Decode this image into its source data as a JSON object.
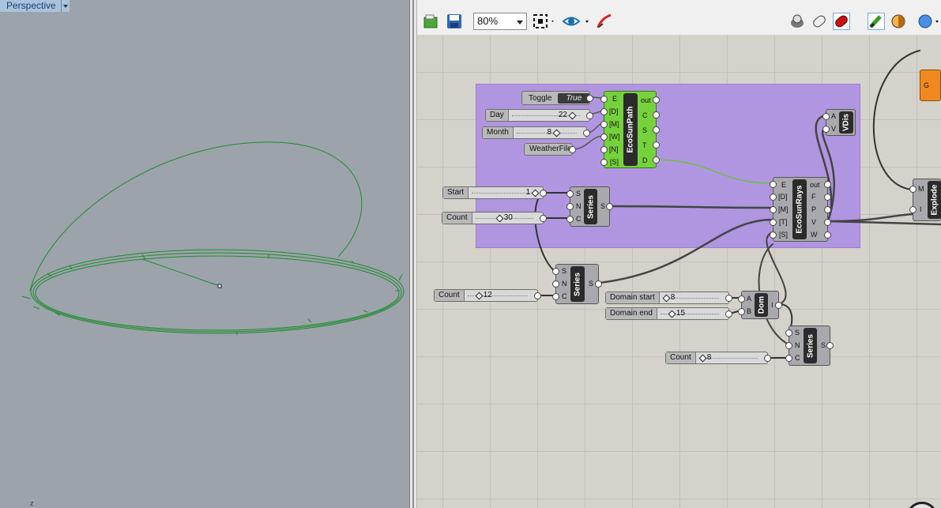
{
  "viewport": {
    "title": "Perspective",
    "axis_label": "z"
  },
  "toolbar": {
    "zoom": "80%"
  },
  "sliders": {
    "day": {
      "label": "Day",
      "value": "22"
    },
    "month": {
      "label": "Month",
      "value": "8"
    },
    "start": {
      "label": "Start",
      "value": "1"
    },
    "count30": {
      "label": "Count",
      "value": "30"
    },
    "count12": {
      "label": "Count",
      "value": "12"
    },
    "dstart": {
      "label": "Domain start",
      "value": "8"
    },
    "dend": {
      "label": "Domain end",
      "value": "15"
    },
    "count8": {
      "label": "Count",
      "value": "8"
    }
  },
  "toggle": {
    "label": "Toggle",
    "state": "True"
  },
  "weather": {
    "label": "WeatherFile"
  },
  "components": {
    "sunpath": {
      "name": "EcoSunPath",
      "inputs": [
        "E",
        "[D]",
        "[M]",
        "[W]",
        "[N]",
        "[S]"
      ],
      "outputs": [
        "out",
        "C",
        "S",
        "T",
        "D"
      ]
    },
    "series1": {
      "name": "Series",
      "inputs": [
        "S",
        "N",
        "C"
      ],
      "outputs": [
        "S"
      ]
    },
    "series2": {
      "name": "Series",
      "inputs": [
        "S",
        "N",
        "C"
      ],
      "outputs": [
        "S"
      ]
    },
    "series3": {
      "name": "Series",
      "inputs": [
        "S",
        "N",
        "C"
      ],
      "outputs": [
        "S"
      ]
    },
    "sunrays": {
      "name": "EcoSunRays",
      "inputs": [
        "E",
        "[D]",
        "[M]",
        "[T]",
        "[S]"
      ],
      "outputs": [
        "out",
        "F",
        "P",
        "V",
        "W"
      ]
    },
    "vdis": {
      "name": "VDis",
      "inputs": [
        "A",
        "V"
      ]
    },
    "dom": {
      "name": "Dom",
      "inputs": [
        "A",
        "B"
      ],
      "outputs": [
        "I"
      ]
    },
    "explode": {
      "name": "Explode",
      "inputs": [
        "M",
        "I"
      ]
    },
    "orange": {
      "input": "G"
    }
  }
}
